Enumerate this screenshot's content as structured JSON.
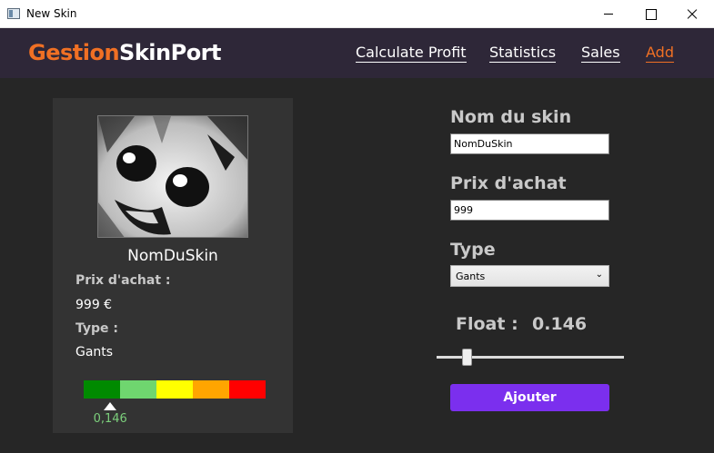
{
  "window": {
    "title": "New Skin"
  },
  "brand": {
    "part1": "Gestion",
    "part2": "SkinPort"
  },
  "nav": {
    "items": [
      {
        "label": "Calculate Profit"
      },
      {
        "label": "Statistics"
      },
      {
        "label": "Sales"
      },
      {
        "label": "Add",
        "active": true
      }
    ]
  },
  "preview": {
    "name": "NomDuSkin",
    "price_label": "Prix d'achat :",
    "price_value": "999 €",
    "type_label": "Type :",
    "type_value": "Gants",
    "wear_colors": [
      "#008a00",
      "#6fd66f",
      "#ffff00",
      "#ffa500",
      "#ff0000"
    ],
    "float_display": "0,146",
    "float_value": 0.146
  },
  "form": {
    "name_label": "Nom du skin",
    "name_value": "NomDuSkin",
    "price_label": "Prix d'achat",
    "price_value": "999",
    "type_label": "Type",
    "type_value": "Gants",
    "float_label": "Float :",
    "float_value": "0.146",
    "slider_value": 0.146,
    "submit_label": "Ajouter"
  },
  "colors": {
    "accent": "#f07024",
    "button": "#7b2fee",
    "header_bg": "#2e2738",
    "body_bg": "#262626"
  }
}
